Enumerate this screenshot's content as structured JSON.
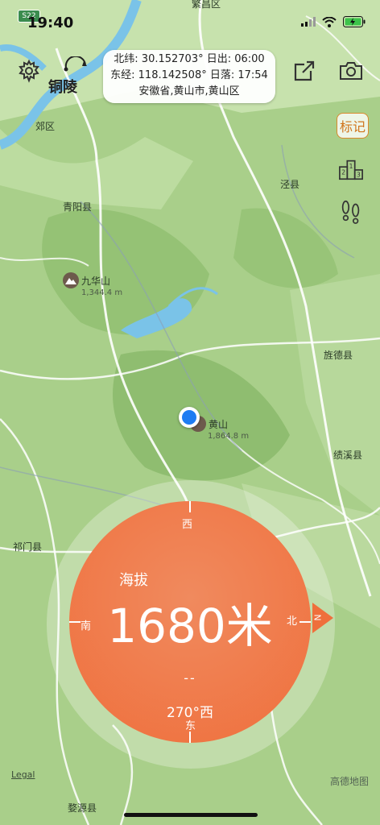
{
  "status_bar": {
    "time": "19:40",
    "road_badge": "S22"
  },
  "info_card": {
    "line1": "北纬: 30.152703° 日出: 06:00",
    "line2": "东经: 118.142508° 日落: 17:54",
    "line3": "安徽省,黄山市,黄山区"
  },
  "buttons": {
    "mark": "标记"
  },
  "map": {
    "places": {
      "tongling": "铜陵",
      "jiaoqu": "郊区",
      "fanchang": "繁昌区",
      "jingxian": "泾县",
      "qingyang": "青阳县",
      "jingde": "旌德县",
      "jixi": "绩溪县",
      "qimen": "祁门县",
      "wuyuan": "婺源县"
    },
    "peaks": {
      "jiuhua_name": "九华山",
      "jiuhua_elev": "1,344.4 m",
      "huangshan_name": "黄山",
      "huangshan_elev": "1,864.8 m"
    },
    "legal": "Legal",
    "provider": "高德地图"
  },
  "compass": {
    "altitude_label": "海拔",
    "altitude_value": "1680米",
    "north": "北",
    "south": "南",
    "west": "西",
    "east": "东",
    "dashes": "--",
    "heading": "270°西",
    "pointer_letter": "N"
  },
  "colors": {
    "land": "#a9cf8a",
    "water": "#7ac3e8",
    "disc": "#ef7a4a",
    "accent": "#d0751c"
  }
}
